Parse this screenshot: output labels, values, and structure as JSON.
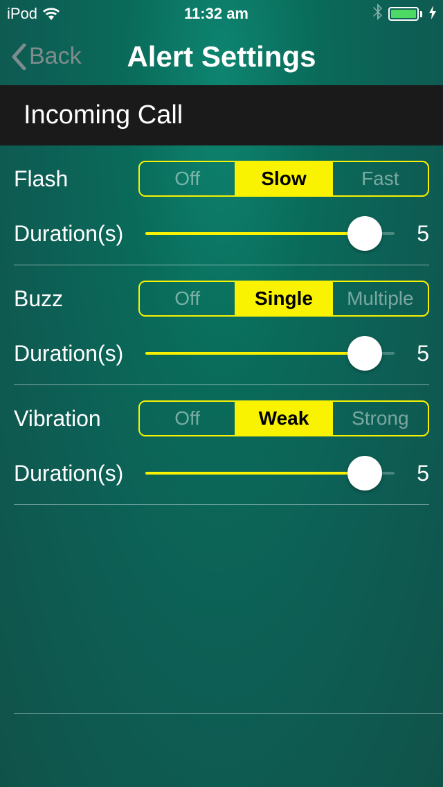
{
  "status_bar": {
    "carrier": "iPod",
    "time": "11:32 am"
  },
  "nav": {
    "back_label": "Back",
    "title": "Alert Settings"
  },
  "section": {
    "title": "Incoming Call"
  },
  "settings": [
    {
      "label": "Flash",
      "options": [
        "Off",
        "Slow",
        "Fast"
      ],
      "selected": 1,
      "duration_label": "Duration(s)",
      "duration_value": 5,
      "duration_max": 5,
      "slider_percent": 88
    },
    {
      "label": "Buzz",
      "options": [
        "Off",
        "Single",
        "Multiple"
      ],
      "selected": 1,
      "duration_label": "Duration(s)",
      "duration_value": 5,
      "duration_max": 5,
      "slider_percent": 88
    },
    {
      "label": "Vibration",
      "options": [
        "Off",
        "Weak",
        "Strong"
      ],
      "selected": 1,
      "duration_label": "Duration(s)",
      "duration_value": 5,
      "duration_max": 5,
      "slider_percent": 88
    }
  ],
  "colors": {
    "accent_yellow": "#f9f200",
    "battery_green": "#4cd964"
  }
}
